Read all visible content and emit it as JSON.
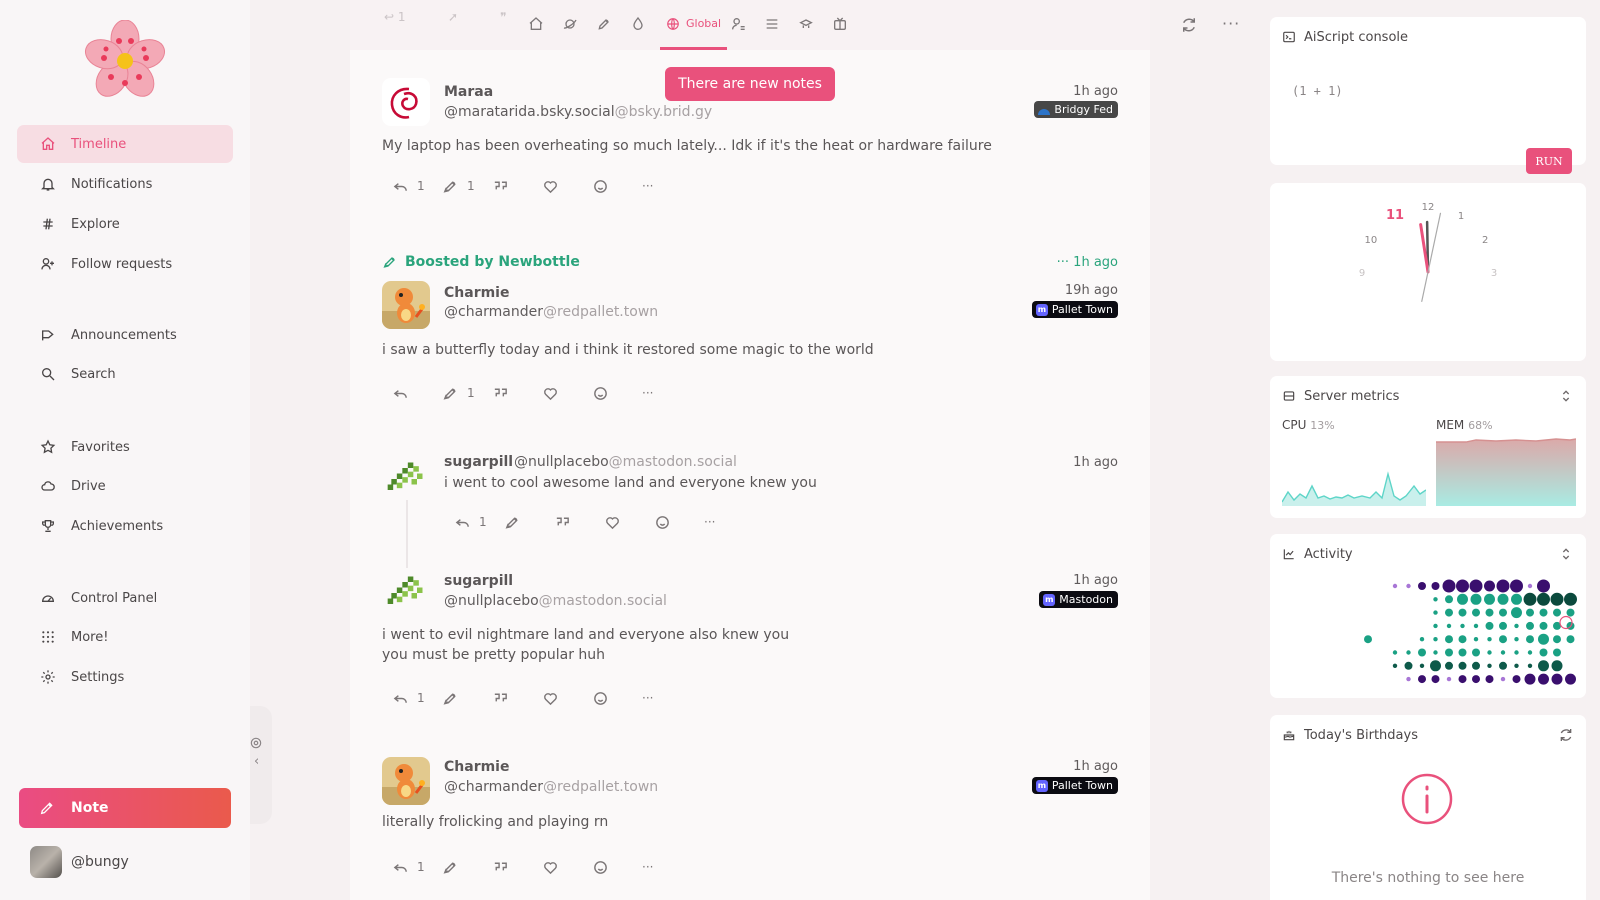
{
  "sidebar": {
    "items": [
      {
        "label": "Timeline",
        "icon": "home-icon",
        "active": true
      },
      {
        "label": "Notifications",
        "icon": "bell-icon"
      },
      {
        "label": "Explore",
        "icon": "hashtag-icon"
      },
      {
        "label": "Follow requests",
        "icon": "user-plus-icon"
      },
      {
        "label": "Announcements",
        "icon": "speakerphone-icon"
      },
      {
        "label": "Search",
        "icon": "search-icon"
      },
      {
        "label": "Favorites",
        "icon": "star-icon"
      },
      {
        "label": "Drive",
        "icon": "cloud-icon"
      },
      {
        "label": "Achievements",
        "icon": "trophy-icon"
      },
      {
        "label": "Control Panel",
        "icon": "dashboard-icon"
      },
      {
        "label": "More!",
        "icon": "grid-dots-icon"
      },
      {
        "label": "Settings",
        "icon": "gear-icon"
      }
    ],
    "note_label": "Note",
    "account": "@bungy"
  },
  "tabs": {
    "active_label": "Global",
    "new_notes": "There are new notes"
  },
  "notes": [
    {
      "name": "Maraa",
      "handle": "@maratarida.bsky.social",
      "host": "@bsky.brid.gy",
      "time": "1h ago",
      "instance": "Bridgy Fed",
      "text": [
        "My laptop has been overheating so much lately... Idk if it's the heat or hardware failure"
      ],
      "counts": {
        "reply": "1",
        "renote": "1"
      }
    },
    {
      "boosted_by_label": "Boosted by",
      "boosted_by": "Newbottle",
      "boost_time": "1h ago",
      "name": "Charmie",
      "handle": "@charmander",
      "host": "@redpallet.town",
      "time": "19h ago",
      "instance": "Pallet Town",
      "text": [
        "i saw a butterfly today and i think it restored some magic to the world"
      ],
      "counts": {
        "reply": "",
        "renote": "1"
      }
    },
    {
      "name": "sugarpill",
      "handle": "@nullplacebo",
      "host": "@mastodon.social",
      "time": "1h ago",
      "text": [
        "i went to cool awesome land and everyone knew you"
      ],
      "counts": {
        "reply": "1",
        "renote": ""
      }
    },
    {
      "name": "sugarpill",
      "handle": "@nullplacebo",
      "host": "@mastodon.social",
      "time": "1h ago",
      "instance": "Mastodon",
      "text": [
        "i went to evil nightmare land and everyone also knew you",
        "you must be pretty popular huh"
      ],
      "counts": {
        "reply": "1",
        "renote": ""
      }
    },
    {
      "name": "Charmie",
      "handle": "@charmander",
      "host": "@redpallet.town",
      "time": "1h ago",
      "instance": "Pallet Town",
      "text": [
        "literally frolicking and playing rn"
      ],
      "counts": {
        "reply": "1",
        "renote": ""
      }
    }
  ],
  "widgets": {
    "console": {
      "title": "AiScript console",
      "code": "(1 + 1)",
      "run": "RUN"
    },
    "clock": {
      "numbers": [
        "12",
        "1",
        "2",
        "3",
        "9",
        "10",
        "11"
      ],
      "hour": 11,
      "minute": 58,
      "second": 32
    },
    "metrics": {
      "title": "Server metrics",
      "cpu_label": "CPU",
      "cpu_value": "13%",
      "mem_label": "MEM",
      "mem_value": "68%",
      "cpu_color": "#5ed5c8",
      "mem_color": "#d9a1a1"
    },
    "activity": {
      "title": "Activity"
    },
    "birthdays": {
      "title": "Today's Birthdays",
      "empty": "There's nothing to see here"
    }
  },
  "colors": {
    "accent": "#e9517c",
    "boost": "#2aa47c"
  }
}
